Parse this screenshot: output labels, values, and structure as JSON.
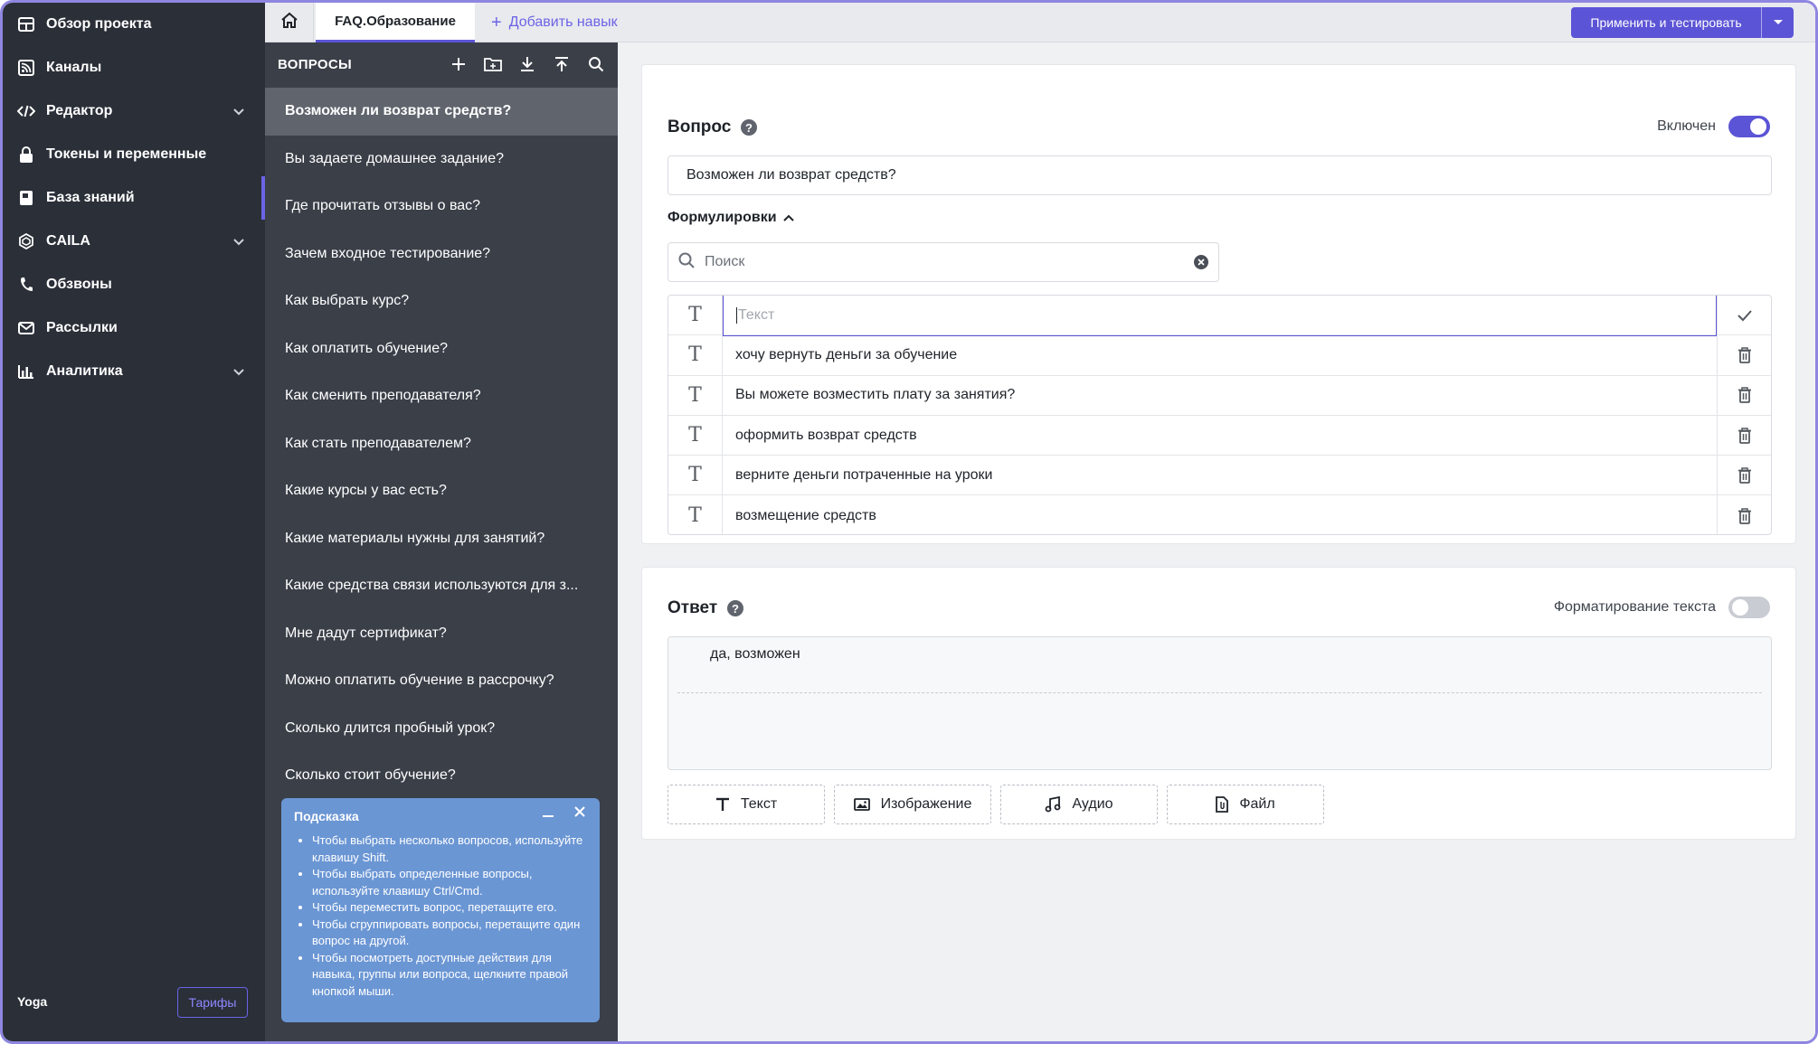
{
  "nav": {
    "items": [
      {
        "label": "Обзор проекта",
        "icon": "grid-icon",
        "chevron": false,
        "active": false
      },
      {
        "label": "Каналы",
        "icon": "rss-icon",
        "chevron": false,
        "active": false
      },
      {
        "label": "Редактор",
        "icon": "code-icon",
        "chevron": true,
        "active": false
      },
      {
        "label": "Токены и переменные",
        "icon": "lock-icon",
        "chevron": false,
        "active": false
      },
      {
        "label": "База знаний",
        "icon": "book-icon",
        "chevron": false,
        "active": true
      },
      {
        "label": "CAILA",
        "icon": "hexagon-icon",
        "chevron": true,
        "active": false
      },
      {
        "label": "Обзвоны",
        "icon": "phone-icon",
        "chevron": false,
        "active": false
      },
      {
        "label": "Рассылки",
        "icon": "mail-icon",
        "chevron": false,
        "active": false
      },
      {
        "label": "Аналитика",
        "icon": "bar-chart-icon",
        "chevron": true,
        "active": false
      }
    ],
    "user": "Yoga",
    "tariff_button": "Тарифы"
  },
  "topbar": {
    "skill_tab": "FAQ.Образование",
    "add_skill": "Добавить навык",
    "apply_button": "Применить и тестировать"
  },
  "questions": {
    "header": "ВОПРОСЫ",
    "items": [
      "Возможен ли возврат средств?",
      "Вы задаете домашнее задание?",
      "Где прочитать отзывы о вас?",
      "Зачем входное тестирование?",
      "Как выбрать курс?",
      "Как оплатить обучение?",
      "Как сменить преподавателя?",
      "Как стать преподавателем?",
      "Какие курсы у вас есть?",
      "Какие материалы нужны для занятий?",
      "Какие средства связи используются для з...",
      "Мне дадут сертификат?",
      "Можно оплатить обучение в рассрочку?",
      "Сколько длится пробный урок?",
      "Сколько стоит обучение?"
    ],
    "selected_index": 0
  },
  "hint": {
    "title": "Подсказка",
    "items": [
      "Чтобы выбрать несколько вопросов, используйте клавишу Shift.",
      "Чтобы выбрать определенные вопросы, используйте клавишу Ctrl/Cmd.",
      "Чтобы переместить вопрос, перетащите его.",
      "Чтобы сгруппировать вопросы, перетащите один вопрос на другой.",
      "Чтобы посмотреть доступные действия для навыка, группы или вопроса, щелкните правой кнопкой мыши."
    ]
  },
  "question_card": {
    "title": "Вопрос",
    "enabled_label": "Включен",
    "enabled": true,
    "question_value": "Возможен ли возврат средств?",
    "formulations_label": "Формулировки",
    "search_placeholder": "Поиск",
    "new_phrase_placeholder": "Текст",
    "phrases": [
      "хочу вернуть деньги за обучение",
      "Вы можете возместить плату за занятия?",
      "оформить возврат средств",
      "верните деньги потраченные на уроки",
      "возмещение средств"
    ]
  },
  "answer_card": {
    "title": "Ответ",
    "format_label": "Форматирование текста",
    "format_enabled": false,
    "answer_text": "да, возможен",
    "buttons": [
      {
        "label": "Текст",
        "icon": "text-icon"
      },
      {
        "label": "Изображение",
        "icon": "image-icon"
      },
      {
        "label": "Аудио",
        "icon": "music-icon"
      },
      {
        "label": "Файл",
        "icon": "file-icon"
      }
    ]
  },
  "colors": {
    "accent": "#5b54d6",
    "nav_bg": "#2a2f38",
    "panel_bg": "#3a3f48",
    "hint_bg": "#6b96d4"
  }
}
